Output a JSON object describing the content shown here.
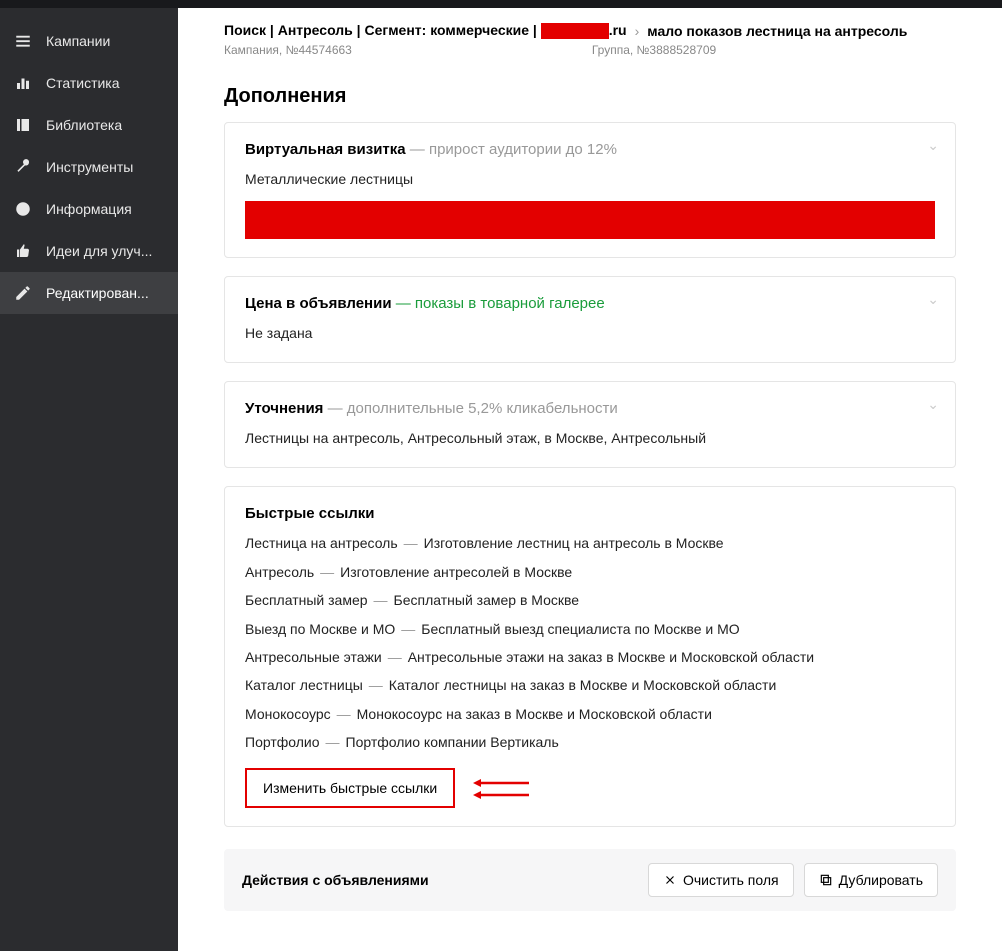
{
  "sidebar": {
    "items": [
      {
        "label": "Кампании"
      },
      {
        "label": "Статистика"
      },
      {
        "label": "Библиотека"
      },
      {
        "label": "Инструменты"
      },
      {
        "label": "Информация"
      },
      {
        "label": "Идеи для улуч..."
      },
      {
        "label": "Редактирован..."
      }
    ]
  },
  "breadcrumb": {
    "campaign_label_prefix": "Поиск | Антресоль | Сегмент: коммерческие | ",
    "campaign_label_suffix": ".ru",
    "campaign_sub": "Кампания, №44574663",
    "group_label": "мало показов лестница на антресоль",
    "group_sub": "Группа, №3888528709"
  },
  "section_title": "Дополнения",
  "card1": {
    "title": "Виртуальная визитка",
    "sub": " — прирост аудитории до 12%",
    "body": "Металлические лестницы"
  },
  "card2": {
    "title": "Цена в объявлении",
    "sub": " — показы в товарной галерее",
    "body": "Не задана"
  },
  "card3": {
    "title": "Уточнения",
    "sub": " — дополнительные 5,2% кликабельности",
    "body": "Лестницы на антресоль, Антресольный этаж, в Москве, Антресольный"
  },
  "card4": {
    "title": "Быстрые ссылки",
    "links": [
      {
        "name": "Лестница на антресоль",
        "desc": "Изготовление лестниц на антресоль в Москве"
      },
      {
        "name": "Антресоль",
        "desc": "Изготовление антресолей в Москве"
      },
      {
        "name": "Бесплатный замер",
        "desc": "Бесплатный замер в Москве"
      },
      {
        "name": "Выезд по Москве и МО",
        "desc": "Бесплатный выезд специалиста по Москве и МО"
      },
      {
        "name": "Антресольные этажи",
        "desc": "Антресольные этажи на заказ в Москве и Московской области"
      },
      {
        "name": "Каталог лестницы",
        "desc": "Каталог лестницы на заказ в Москве и Московской области"
      },
      {
        "name": "Монокосоурс",
        "desc": "Монокосоурс на заказ в Москве и Московской области"
      },
      {
        "name": "Портфолио",
        "desc": "Портфолио компании Вертикаль"
      }
    ],
    "button": "Изменить быстрые ссылки"
  },
  "actions": {
    "label": "Действия с объявлениями",
    "clear": "Очистить поля",
    "duplicate": "Дублировать"
  },
  "dash": " — "
}
